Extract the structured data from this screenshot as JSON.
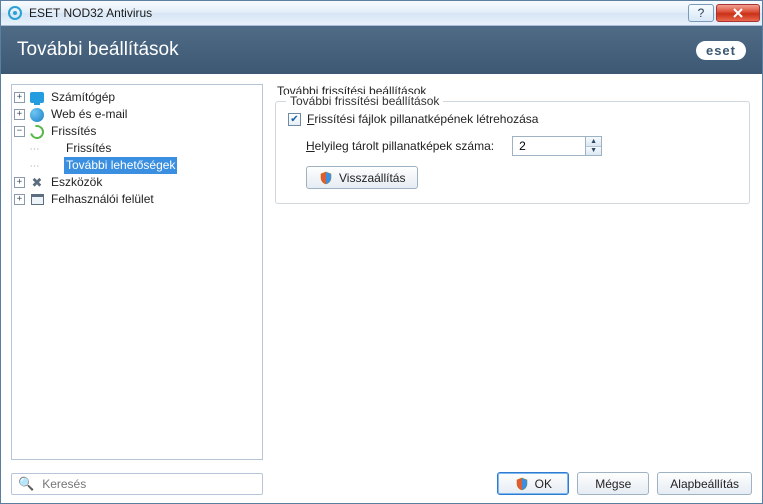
{
  "titlebar": {
    "title": "ESET NOD32 Antivirus"
  },
  "header": {
    "heading": "További beállítások",
    "logo": "eset"
  },
  "tree": {
    "items": [
      {
        "label": "Számítógép"
      },
      {
        "label": "Web és e-mail"
      },
      {
        "label": "Frissítés"
      },
      {
        "label": "Frissítés"
      },
      {
        "label": "További lehetőségek"
      },
      {
        "label": "Eszközök"
      },
      {
        "label": "Felhasználói felület"
      }
    ]
  },
  "content": {
    "section_title": "További frissítési beállítások",
    "group_legend": "További frissítési beállítások",
    "checkbox_label": "Frissítési fájlok pillanatképének létrehozása",
    "spinner_label": "Helyileg tárolt pillanatképek száma:",
    "spinner_value": "2",
    "reset_label": "Visszaállítás"
  },
  "bottom": {
    "search_placeholder": "Keresés",
    "ok": "OK",
    "cancel": "Mégse",
    "default": "Alapbeállítás"
  }
}
